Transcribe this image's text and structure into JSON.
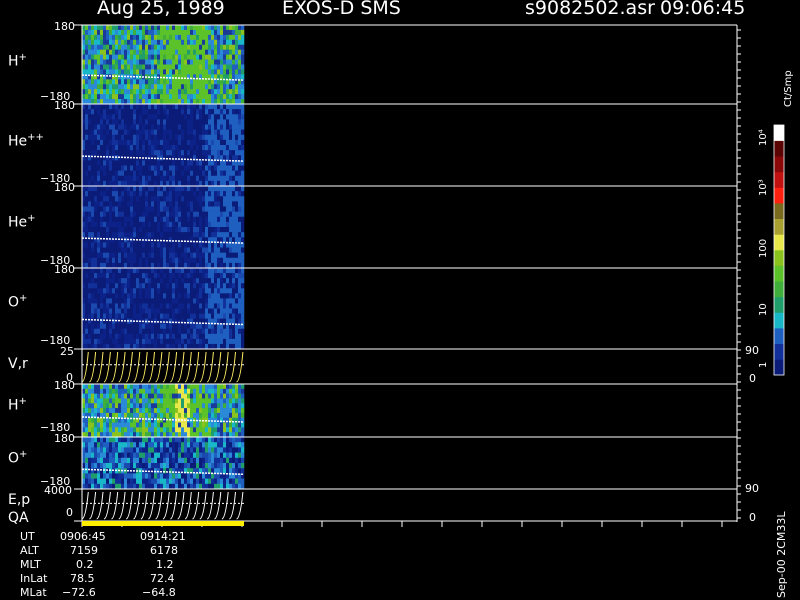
{
  "header": {
    "date": "Aug 25, 1989",
    "instrument": "EXOS-D SMS",
    "file": "s9082502.asr",
    "time": "09:06:45"
  },
  "colors": {
    "trace": "#ffffff",
    "qa_bar": "#ffee00",
    "frame": "#ffffff",
    "background": "#000000"
  },
  "panels": [
    {
      "name": "H+",
      "species": "H",
      "charge": "+",
      "type": "spectrogram",
      "ytop": "180",
      "ybot": "−180",
      "intensity": "high"
    },
    {
      "name": "He++",
      "species": "He",
      "charge": "++",
      "type": "spectrogram",
      "ytop": "180",
      "ybot": "−180",
      "intensity": "low"
    },
    {
      "name": "He+",
      "species": "He",
      "charge": "+",
      "type": "spectrogram",
      "ytop": "180",
      "ybot": "−180",
      "intensity": "low"
    },
    {
      "name": "O+",
      "species": "O",
      "charge": "+",
      "type": "spectrogram",
      "ytop": "180",
      "ybot": "−180",
      "intensity": "low"
    },
    {
      "name": "V,r",
      "species": "V,r",
      "charge": "",
      "type": "line",
      "ytop": "25",
      "ybot": "0",
      "rtop": "90",
      "rbot": "0"
    },
    {
      "name": "H+",
      "species": "H",
      "charge": "+",
      "type": "spectrogram",
      "ytop": "180",
      "ybot": "−180",
      "intensity": "high"
    },
    {
      "name": "O+",
      "species": "O",
      "charge": "+",
      "type": "spectrogram",
      "ytop": "180",
      "ybot": "−180",
      "intensity": "medium"
    },
    {
      "name": "E,p",
      "species": "E,p",
      "charge": "",
      "type": "line",
      "ytop": "4000",
      "ybot": "0",
      "rtop": "90",
      "rbot": "0"
    }
  ],
  "qa_label": "QA",
  "colorbar": {
    "title": "Ct/Smp",
    "scale": "log",
    "ticks": [
      "1",
      "10",
      "100",
      "10³",
      "10⁴"
    ]
  },
  "orbit_info": {
    "rows": [
      {
        "label": "UT",
        "v1": "0906:45",
        "v2": "0914:21"
      },
      {
        "label": "ALT",
        "v1": "7159",
        "v2": "6178"
      },
      {
        "label": "MLT",
        "v1": "0.2",
        "v2": "1.2"
      },
      {
        "label": "InLat",
        "v1": "78.5",
        "v2": "72.4"
      },
      {
        "label": "MLat",
        "v1": "−72.6",
        "v2": "−64.8"
      }
    ]
  },
  "footer": "Sep-00 2CM33L",
  "chart_data": {
    "type": "heatmap",
    "title": "Aug 25, 1989   EXOS-D SMS",
    "series": [
      {
        "name": "H+"
      },
      {
        "name": "He++"
      },
      {
        "name": "He+"
      },
      {
        "name": "O+"
      },
      {
        "name": "V,r"
      },
      {
        "name": "H+"
      },
      {
        "name": "O+"
      },
      {
        "name": "E,p"
      }
    ],
    "ylim_spectrogram": [
      -180,
      180
    ],
    "ylim_vr": [
      0,
      25
    ],
    "ylim_ep": [
      0,
      4000
    ],
    "x_range_ut": [
      "0906:45",
      "0914:21"
    ],
    "colorbar_range": [
      1,
      10000
    ],
    "colorbar_scale": "log"
  }
}
